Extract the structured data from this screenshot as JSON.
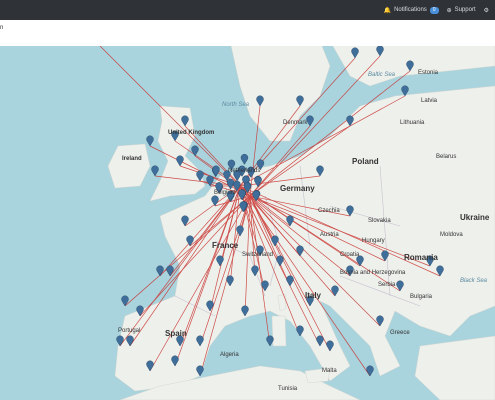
{
  "topbar": {
    "notifications_label": "Notifications",
    "notifications_count": "0",
    "support_label": "Support"
  },
  "subbar": {
    "left_text": "n"
  },
  "map": {
    "labels": {
      "uk": "United Kingdom",
      "ireland": "Ireland",
      "france": "France",
      "spain": "Spain",
      "portugal": "Portugal",
      "italy": "Italy",
      "germany": "Germany",
      "poland": "Poland",
      "czechia": "Czechia",
      "austria": "Austria",
      "hungary": "Hungary",
      "romania": "Romania",
      "ukraine": "Ukraine",
      "belarus": "Belarus",
      "lithuania": "Lithuania",
      "latvia": "Latvia",
      "estonia": "Estonia",
      "denmark": "Denmark",
      "moldova": "Moldova",
      "bulgaria": "Bulgaria",
      "greece": "Greece",
      "serbia": "Serbia",
      "tunisia": "Tunisia",
      "algeria": "Algeria",
      "malta": "Malta",
      "north_sea": "North Sea",
      "baltic_sea": "Baltic Sea",
      "black_sea": "Black Sea",
      "bosnia": "Bosnia and Herzegovina",
      "slovakia": "Slovakia",
      "croatia": "Croatia",
      "belgium": "Belgium",
      "netherlands": "Netherlands",
      "switzerland": "Switzerland"
    }
  },
  "colors": {
    "topbar": "#2f3337",
    "sea": "#a9d3dd",
    "land": "#eef0ec",
    "route": "#c9302c",
    "marker": "#3f6e9a"
  }
}
